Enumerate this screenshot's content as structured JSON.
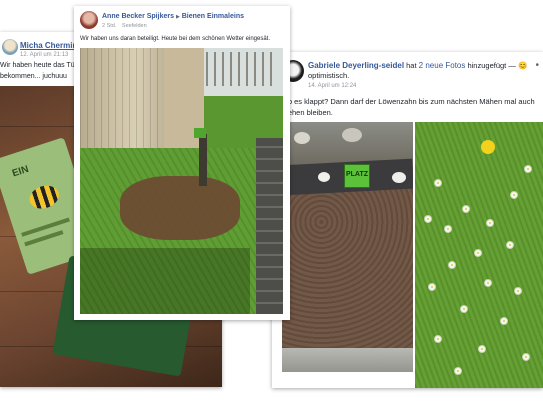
{
  "post1": {
    "author": "Micha Chermin",
    "date": "12. April um 21:13",
    "text_line1": "Wir haben heute das Tüt",
    "text_line2": "bekommen... juchuuu",
    "photo_text": "EIN"
  },
  "post2": {
    "author": "Anne Becker Spijkers",
    "arrow": "▶",
    "group": "Bienen Einmaleins",
    "time": "2 Std.",
    "tag": "Seefelden",
    "text": "Wir haben uns daran beteiligt. Heute bei dem schönen Wetter eingesät."
  },
  "post3": {
    "author": "Gabriele Deyerling-seidel",
    "action_pre": "hat",
    "action_link": "2 neue Fotos",
    "action_post": "hinzugefügt —",
    "feeling_emoji": "😊",
    "feeling": "optimistisch.",
    "date": "14. April um 12:24",
    "text": "Ob es klappt? Dann darf der Löwenzahn bis zum nächsten Mähen mal auch stehen bleiben.",
    "sign_label": "PLATZ",
    "menu": "•"
  },
  "colors": {
    "link": "#365899",
    "meta": "#90949c",
    "lawn": "#5d9a2a",
    "soil": "#6b5140"
  }
}
